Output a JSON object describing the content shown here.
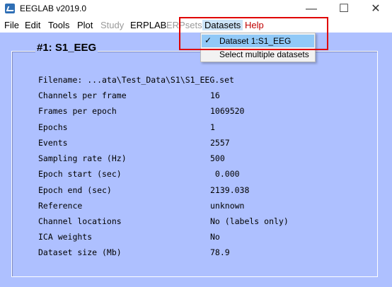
{
  "window": {
    "title": "EEGLAB v2019.0",
    "minimize_glyph": "—",
    "maximize_glyph": "☐",
    "close_glyph": "✕"
  },
  "menubar": {
    "items": [
      {
        "label": "File",
        "state": "normal"
      },
      {
        "label": "Edit",
        "state": "normal"
      },
      {
        "label": "Tools",
        "state": "normal"
      },
      {
        "label": "Plot",
        "state": "normal"
      },
      {
        "label": "Study",
        "state": "disabled"
      },
      {
        "label": "ERPLAB",
        "state": "normal"
      },
      {
        "label": "ERPsets",
        "state": "disabled"
      },
      {
        "label": "Datasets",
        "state": "active"
      },
      {
        "label": "Help",
        "state": "help"
      }
    ]
  },
  "datasets_menu": {
    "items": [
      {
        "label": "Dataset 1:S1_EEG",
        "checked": true,
        "check_glyph": "✓"
      },
      {
        "label": "Select multiple datasets",
        "checked": false
      }
    ]
  },
  "panel": {
    "title": "#1: S1_EEG",
    "rows": [
      {
        "label": "Filename: ...ata\\Test_Data\\S1\\S1_EEG.set",
        "value": ""
      },
      {
        "label": "Channels per frame",
        "value": "16"
      },
      {
        "label": "Frames per epoch",
        "value": "1069520"
      },
      {
        "label": "Epochs",
        "value": "1"
      },
      {
        "label": "Events",
        "value": "2557"
      },
      {
        "label": "Sampling rate (Hz)",
        "value": "500"
      },
      {
        "label": "Epoch start (sec)",
        "value": " 0.000"
      },
      {
        "label": "Epoch end (sec)",
        "value": "2139.038"
      },
      {
        "label": "Reference",
        "value": "unknown"
      },
      {
        "label": "Channel locations",
        "value": "No (labels only)"
      },
      {
        "label": "ICA weights",
        "value": "No"
      },
      {
        "label": "Dataset size (Mb)",
        "value": "78.9"
      }
    ]
  },
  "colors": {
    "background": "#aec0ff",
    "highlight_box": "#e00000",
    "help_menu": "#c00000",
    "selected_item": "#91c9f7"
  }
}
